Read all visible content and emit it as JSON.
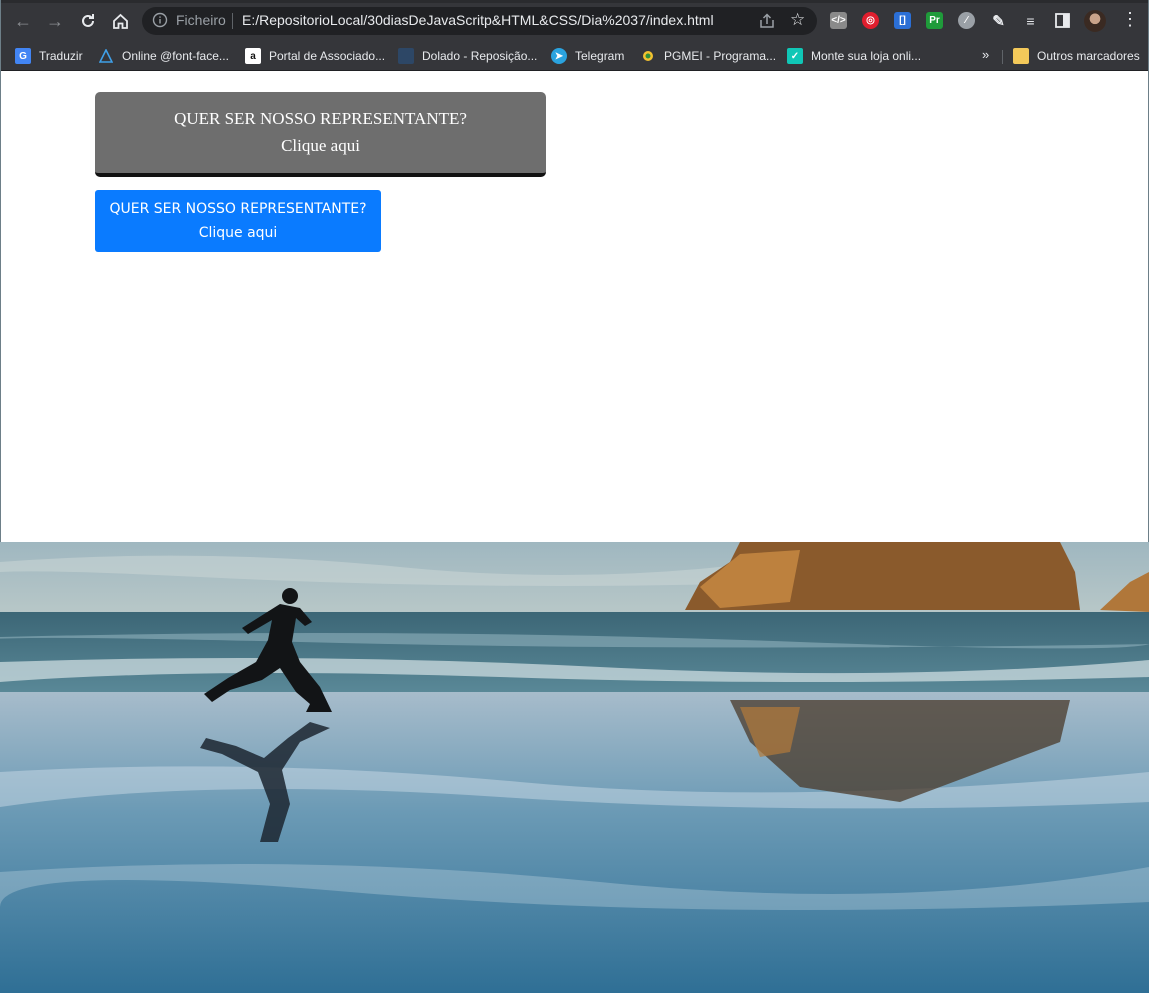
{
  "browser": {
    "address_scheme": "Ficheiro",
    "address_url": "E:/RepositorioLocal/30diasDeJavaScritp&HTML&CSS/Dia%2037/index.html",
    "extensions": [
      "code-extension-icon",
      "target-extension-icon",
      "bracket-extension-icon",
      "pr-extension-icon",
      "dev-extension-icon",
      "puzzle-icon",
      "media-queue-icon",
      "side-panel-icon"
    ]
  },
  "bookmarks": {
    "items": [
      {
        "label": "Traduzir",
        "icon": "google-translate-icon"
      },
      {
        "label": "Online @font-face...",
        "icon": "font-triangle-icon"
      },
      {
        "label": "Portal de Associado...",
        "icon": "amazon-icon"
      },
      {
        "label": "Dolado - Reposição...",
        "icon": "dolado-icon"
      },
      {
        "label": "Telegram",
        "icon": "telegram-icon"
      },
      {
        "label": "PGMEI - Programa...",
        "icon": "pgmei-icon"
      },
      {
        "label": "Monte sua loja onli...",
        "icon": "check-icon"
      }
    ],
    "more": "»",
    "other_folder": "Outros marcadores"
  },
  "page": {
    "button_gray": {
      "line1": "QUER SER NOSSO REPRESENTANTE?",
      "line2": "Clique aqui"
    },
    "button_blue": {
      "line1": "QUER SER NOSSO REPRESENTANTE?",
      "line2": "Clique aqui"
    }
  },
  "colors": {
    "chrome_dark": "#35363a",
    "omnibox": "#202124",
    "gray_button": "#6e6e6e",
    "blue_button": "#0a7bff"
  }
}
